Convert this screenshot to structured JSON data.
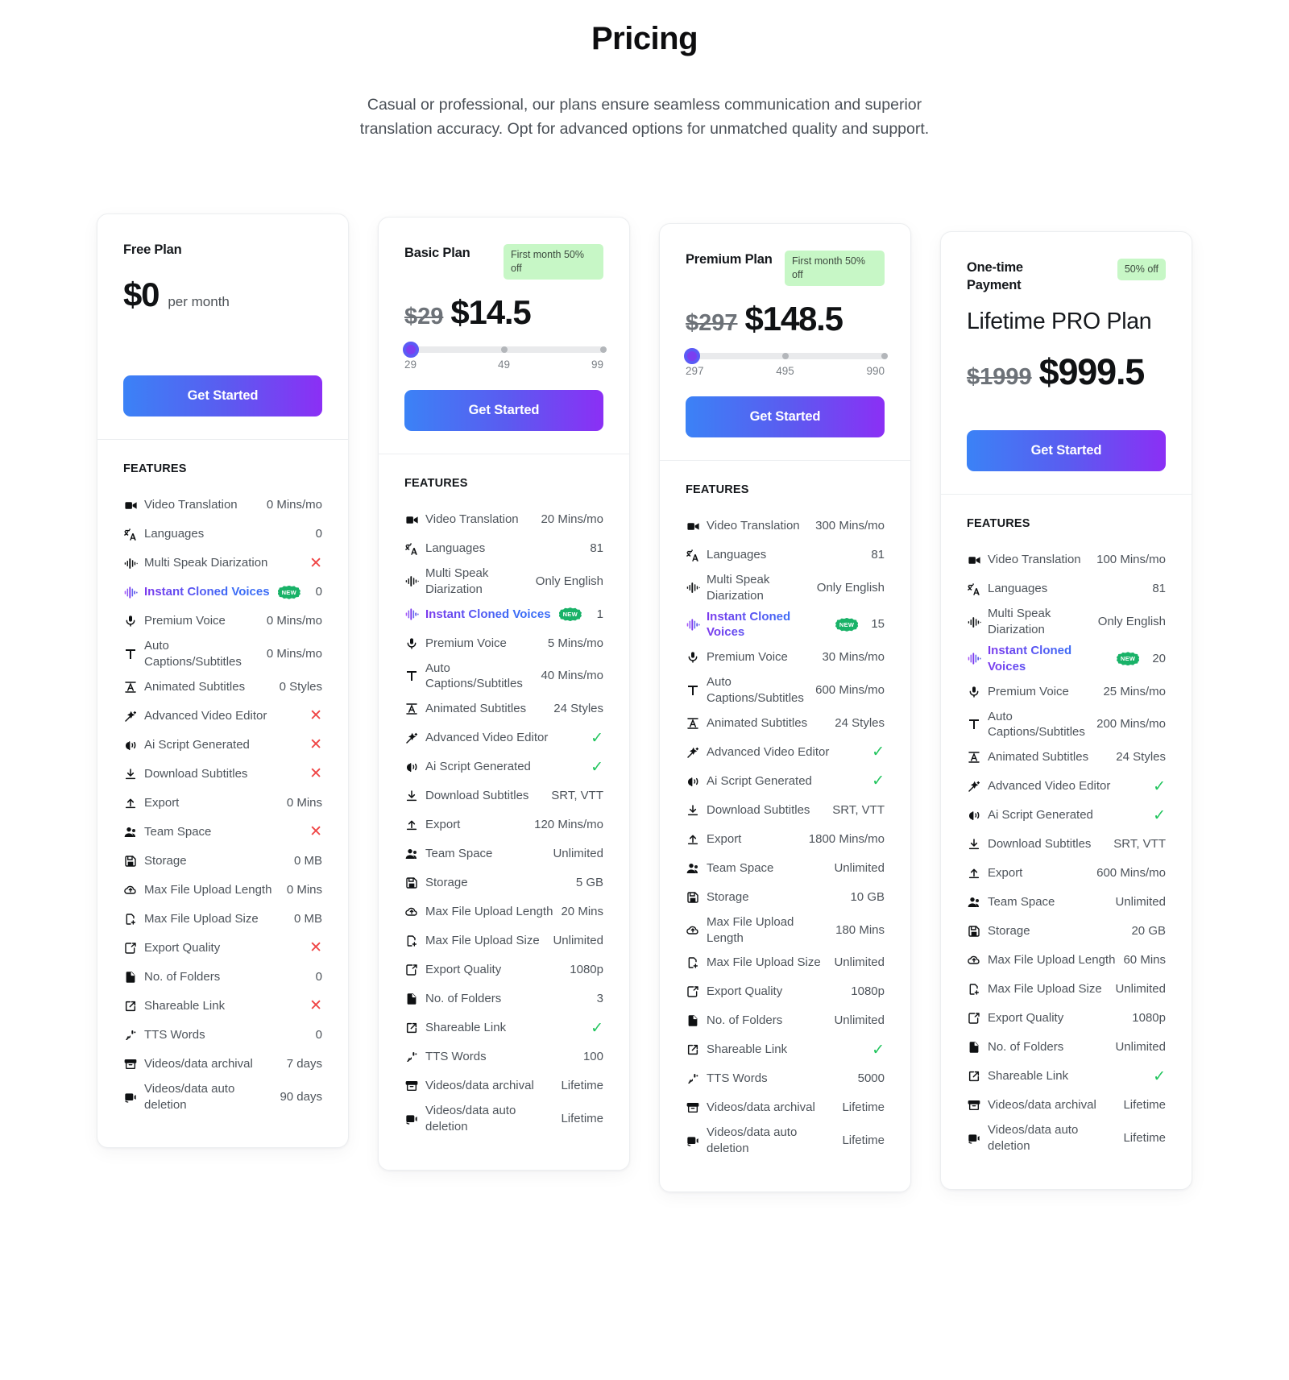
{
  "hero": {
    "title": "Pricing",
    "subtitle": "Casual or professional, our plans ensure seamless communication and superior translation accuracy. Opt for advanced options for unmatched quality and support."
  },
  "features_heading": "FEATURES",
  "cta_label": "Get Started",
  "icons": {
    "video": "video-camera-icon",
    "languages": "translate-icon",
    "waveform": "waveform-icon",
    "cloned": "voice-wave-icon",
    "mic": "microphone-icon",
    "text": "text-T-icon",
    "animated": "animated-text-icon",
    "wand": "magic-wand-icon",
    "script": "ai-speech-icon",
    "download": "download-icon",
    "upload": "upload-icon",
    "team": "team-users-icon",
    "storage": "floppy-disk-icon",
    "cloudup": "cloud-upload-icon",
    "filesize": "file-plus-icon",
    "quality": "export-share-icon",
    "folder": "file-icon",
    "link": "external-link-icon",
    "tts": "tts-mic-icon",
    "archive": "archive-box-icon",
    "autodelete": "auto-delete-icon"
  },
  "new_badge_label": "NEW",
  "plans": [
    {
      "name": "Free Plan",
      "badge": null,
      "price_old": null,
      "price_new": "$0",
      "price_per": "per month",
      "title_big": null,
      "slider": null,
      "features": [
        {
          "icon": "video",
          "label": "Video Translation",
          "value": "0 Mins/mo"
        },
        {
          "icon": "languages",
          "label": "Languages",
          "value": "0"
        },
        {
          "icon": "waveform",
          "label": "Multi Speak Diarization",
          "value": "cross"
        },
        {
          "icon": "cloned",
          "label": "Instant Cloned Voices",
          "value": "0",
          "highlight": true,
          "new": true
        },
        {
          "icon": "mic",
          "label": "Premium Voice",
          "value": "0 Mins/mo"
        },
        {
          "icon": "text",
          "label": "Auto Captions/Subtitles",
          "value": "0 Mins/mo"
        },
        {
          "icon": "animated",
          "label": "Animated Subtitles",
          "value": "0 Styles"
        },
        {
          "icon": "wand",
          "label": "Advanced Video Editor",
          "value": "cross"
        },
        {
          "icon": "script",
          "label": "Ai Script Generated",
          "value": "cross"
        },
        {
          "icon": "download",
          "label": "Download Subtitles",
          "value": "cross"
        },
        {
          "icon": "upload",
          "label": "Export",
          "value": "0 Mins"
        },
        {
          "icon": "team",
          "label": "Team Space",
          "value": "cross"
        },
        {
          "icon": "storage",
          "label": "Storage",
          "value": "0 MB"
        },
        {
          "icon": "cloudup",
          "label": "Max File Upload Length",
          "value": "0 Mins"
        },
        {
          "icon": "filesize",
          "label": "Max File Upload Size",
          "value": "0 MB"
        },
        {
          "icon": "quality",
          "label": "Export Quality",
          "value": "cross"
        },
        {
          "icon": "folder",
          "label": "No. of Folders",
          "value": "0"
        },
        {
          "icon": "link",
          "label": "Shareable Link",
          "value": "cross"
        },
        {
          "icon": "tts",
          "label": "TTS Words",
          "value": "0"
        },
        {
          "icon": "archive",
          "label": "Videos/data archival",
          "value": "7 days"
        },
        {
          "icon": "autodelete",
          "label": "Videos/data auto deletion",
          "value": "90 days"
        }
      ]
    },
    {
      "name": "Basic Plan",
      "badge": "First month 50% off",
      "price_old": "$29",
      "price_new": "$14.5",
      "price_per": null,
      "title_big": null,
      "slider": {
        "min": "29",
        "mid": "49",
        "max": "99"
      },
      "features": [
        {
          "icon": "video",
          "label": "Video Translation",
          "value": "20 Mins/mo"
        },
        {
          "icon": "languages",
          "label": "Languages",
          "value": "81"
        },
        {
          "icon": "waveform",
          "label": "Multi Speak Diarization",
          "value": "Only English"
        },
        {
          "icon": "cloned",
          "label": "Instant Cloned Voices",
          "value": "1",
          "highlight": true,
          "new": true
        },
        {
          "icon": "mic",
          "label": "Premium Voice",
          "value": "5 Mins/mo"
        },
        {
          "icon": "text",
          "label": "Auto Captions/Subtitles",
          "value": "40 Mins/mo"
        },
        {
          "icon": "animated",
          "label": "Animated Subtitles",
          "value": "24 Styles"
        },
        {
          "icon": "wand",
          "label": "Advanced Video Editor",
          "value": "check"
        },
        {
          "icon": "script",
          "label": "Ai Script Generated",
          "value": "check"
        },
        {
          "icon": "download",
          "label": "Download Subtitles",
          "value": "SRT, VTT"
        },
        {
          "icon": "upload",
          "label": "Export",
          "value": "120 Mins/mo"
        },
        {
          "icon": "team",
          "label": "Team Space",
          "value": "Unlimited"
        },
        {
          "icon": "storage",
          "label": "Storage",
          "value": "5 GB"
        },
        {
          "icon": "cloudup",
          "label": "Max File Upload Length",
          "value": "20 Mins"
        },
        {
          "icon": "filesize",
          "label": "Max File Upload Size",
          "value": "Unlimited"
        },
        {
          "icon": "quality",
          "label": "Export Quality",
          "value": "1080p"
        },
        {
          "icon": "folder",
          "label": "No. of Folders",
          "value": "3"
        },
        {
          "icon": "link",
          "label": "Shareable Link",
          "value": "check"
        },
        {
          "icon": "tts",
          "label": "TTS Words",
          "value": "100"
        },
        {
          "icon": "archive",
          "label": "Videos/data archival",
          "value": "Lifetime"
        },
        {
          "icon": "autodelete",
          "label": "Videos/data auto deletion",
          "value": "Lifetime"
        }
      ]
    },
    {
      "name": "Premium Plan",
      "badge": "First month 50% off",
      "price_old": "$297",
      "price_new": "$148.5",
      "price_per": null,
      "title_big": null,
      "slider": {
        "min": "297",
        "mid": "495",
        "max": "990"
      },
      "features": [
        {
          "icon": "video",
          "label": "Video Translation",
          "value": "300 Mins/mo"
        },
        {
          "icon": "languages",
          "label": "Languages",
          "value": "81"
        },
        {
          "icon": "waveform",
          "label": "Multi Speak Diarization",
          "value": "Only English"
        },
        {
          "icon": "cloned",
          "label": "Instant Cloned Voices",
          "value": "15",
          "highlight": true,
          "new": true
        },
        {
          "icon": "mic",
          "label": "Premium Voice",
          "value": "30 Mins/mo"
        },
        {
          "icon": "text",
          "label": "Auto Captions/Subtitles",
          "value": "600 Mins/mo"
        },
        {
          "icon": "animated",
          "label": "Animated Subtitles",
          "value": "24 Styles"
        },
        {
          "icon": "wand",
          "label": "Advanced Video Editor",
          "value": "check"
        },
        {
          "icon": "script",
          "label": "Ai Script Generated",
          "value": "check"
        },
        {
          "icon": "download",
          "label": "Download Subtitles",
          "value": "SRT, VTT"
        },
        {
          "icon": "upload",
          "label": "Export",
          "value": "1800 Mins/mo"
        },
        {
          "icon": "team",
          "label": "Team Space",
          "value": "Unlimited"
        },
        {
          "icon": "storage",
          "label": "Storage",
          "value": "10 GB"
        },
        {
          "icon": "cloudup",
          "label": "Max File Upload Length",
          "value": "180 Mins"
        },
        {
          "icon": "filesize",
          "label": "Max File Upload Size",
          "value": "Unlimited"
        },
        {
          "icon": "quality",
          "label": "Export Quality",
          "value": "1080p"
        },
        {
          "icon": "folder",
          "label": "No. of Folders",
          "value": "Unlimited"
        },
        {
          "icon": "link",
          "label": "Shareable Link",
          "value": "check"
        },
        {
          "icon": "tts",
          "label": "TTS Words",
          "value": "5000"
        },
        {
          "icon": "archive",
          "label": "Videos/data archival",
          "value": "Lifetime"
        },
        {
          "icon": "autodelete",
          "label": "Videos/data auto deletion",
          "value": "Lifetime"
        }
      ]
    },
    {
      "name": "One-time Payment",
      "badge": "50% off",
      "badge_compact": true,
      "price_old": "$1999",
      "price_new": "$999.5",
      "price_per": null,
      "title_big": "Lifetime PRO Plan",
      "slider": null,
      "features": [
        {
          "icon": "video",
          "label": "Video Translation",
          "value": "100 Mins/mo"
        },
        {
          "icon": "languages",
          "label": "Languages",
          "value": "81"
        },
        {
          "icon": "waveform",
          "label": "Multi Speak Diarization",
          "value": "Only English"
        },
        {
          "icon": "cloned",
          "label": "Instant Cloned Voices",
          "value": "20",
          "highlight": true,
          "new": true
        },
        {
          "icon": "mic",
          "label": "Premium Voice",
          "value": "25 Mins/mo"
        },
        {
          "icon": "text",
          "label": "Auto Captions/Subtitles",
          "value": "200 Mins/mo"
        },
        {
          "icon": "animated",
          "label": "Animated Subtitles",
          "value": "24 Styles"
        },
        {
          "icon": "wand",
          "label": "Advanced Video Editor",
          "value": "check"
        },
        {
          "icon": "script",
          "label": "Ai Script Generated",
          "value": "check"
        },
        {
          "icon": "download",
          "label": "Download Subtitles",
          "value": "SRT, VTT"
        },
        {
          "icon": "upload",
          "label": "Export",
          "value": "600 Mins/mo"
        },
        {
          "icon": "team",
          "label": "Team Space",
          "value": "Unlimited"
        },
        {
          "icon": "storage",
          "label": "Storage",
          "value": "20 GB"
        },
        {
          "icon": "cloudup",
          "label": "Max File Upload Length",
          "value": "60 Mins"
        },
        {
          "icon": "filesize",
          "label": "Max File Upload Size",
          "value": "Unlimited"
        },
        {
          "icon": "quality",
          "label": "Export Quality",
          "value": "1080p"
        },
        {
          "icon": "folder",
          "label": "No. of Folders",
          "value": "Unlimited"
        },
        {
          "icon": "link",
          "label": "Shareable Link",
          "value": "check"
        },
        {
          "icon": "archive",
          "label": "Videos/data archival",
          "value": "Lifetime"
        },
        {
          "icon": "autodelete",
          "label": "Videos/data auto deletion",
          "value": "Lifetime"
        }
      ]
    }
  ],
  "colors": {
    "accent_start": "#3b82f6",
    "accent_end": "#8b2ff5",
    "badge_bg": "#c7f7c6",
    "check": "#22c55e",
    "cross": "#ef4444",
    "new_badge": "#19b268"
  }
}
